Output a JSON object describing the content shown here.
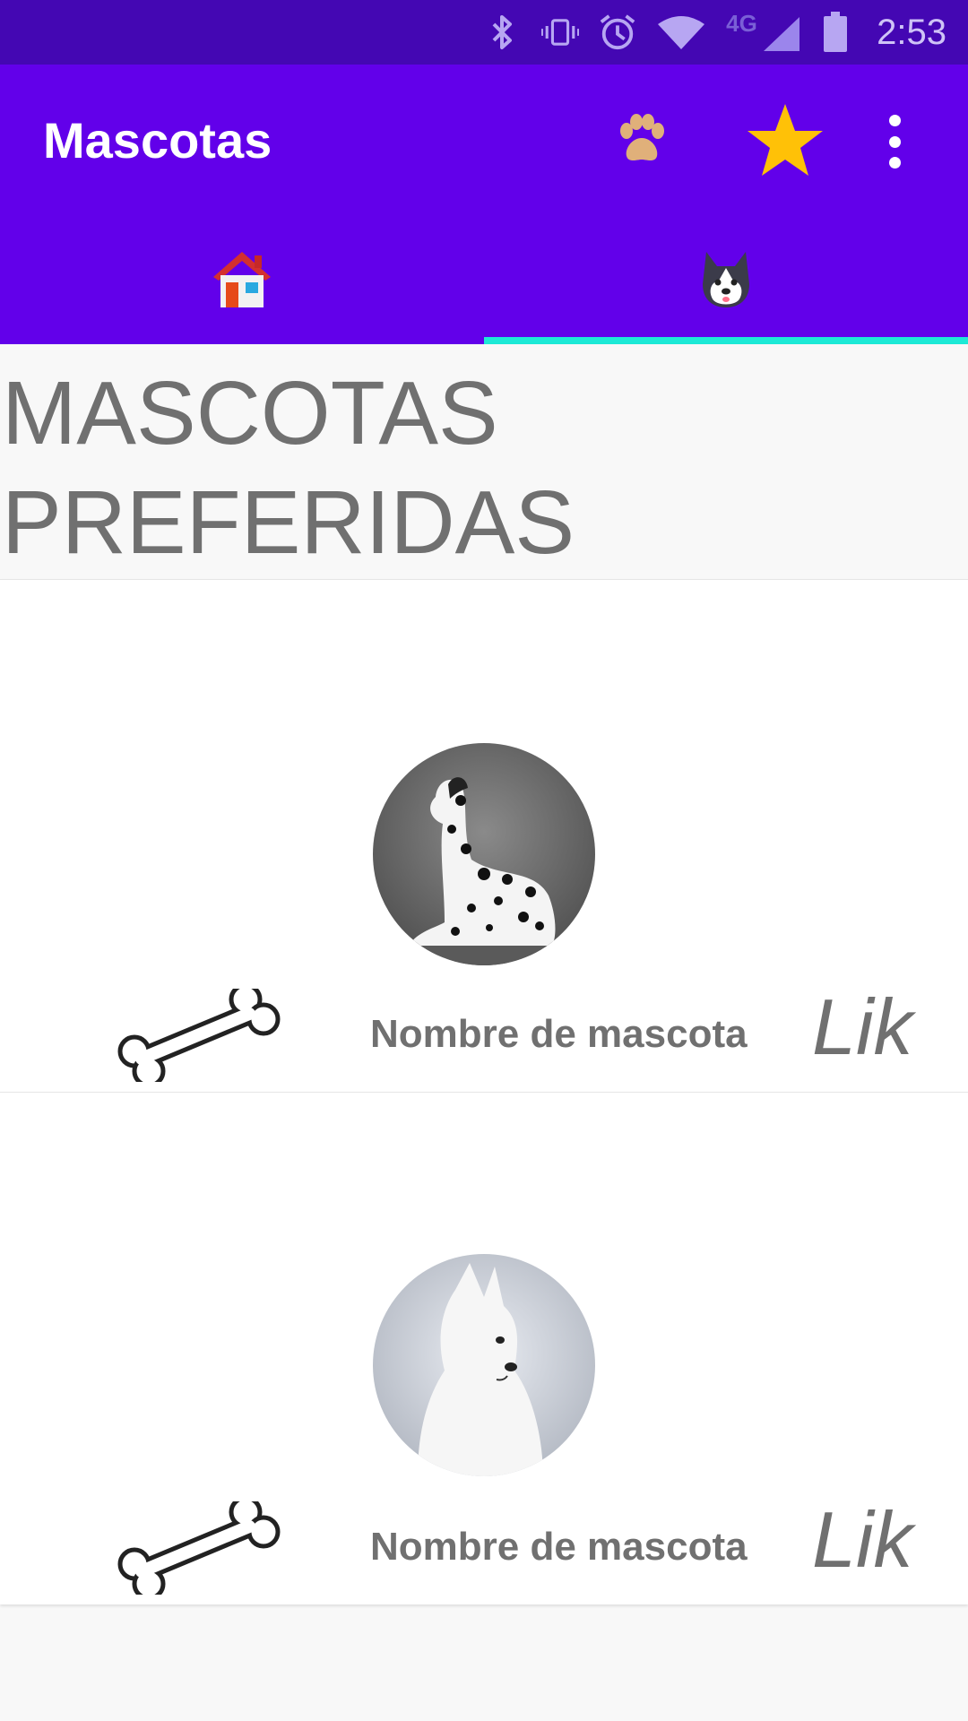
{
  "status_bar": {
    "time": "2:53",
    "network": "4G",
    "icons": [
      "bluetooth-icon",
      "vibrate-icon",
      "alarm-icon",
      "wifi-icon",
      "signal-icon",
      "battery-icon"
    ]
  },
  "app_bar": {
    "title": "Mascotas",
    "actions": [
      "paw-icon",
      "star-icon",
      "more-options-icon"
    ]
  },
  "tabs": [
    {
      "icon": "house-icon",
      "selected": false
    },
    {
      "icon": "husky-icon",
      "selected": true
    }
  ],
  "heading": "MASCOTAS PREFERIDAS",
  "pets": [
    {
      "name": "Nombre de mascota",
      "like_label": "Lik",
      "photo": "dalmatian-photo",
      "action_icon": "bone-icon"
    },
    {
      "name": "Nombre de mascota",
      "like_label": "Lik",
      "photo": "white-dog-photo",
      "action_icon": "bone-icon"
    }
  ],
  "colors": {
    "status_bar": "#4407b3",
    "primary": "#6200ea",
    "tab_indicator": "#1de9d6",
    "text_gray": "#707070",
    "star": "#ffc107"
  }
}
